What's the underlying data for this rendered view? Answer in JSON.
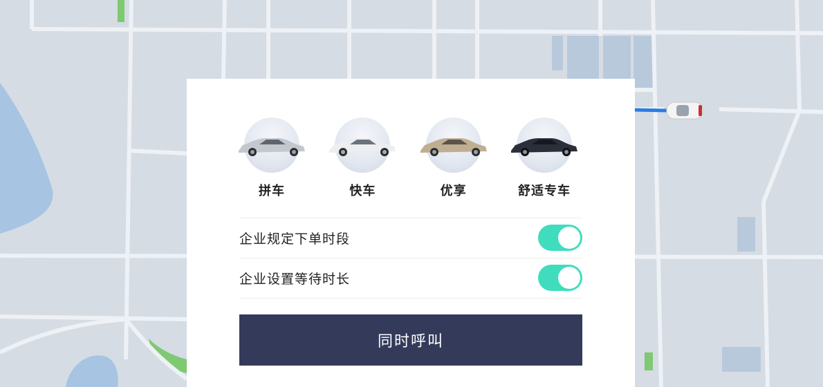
{
  "colors": {
    "accent": "#3fdcbd",
    "primary_button": "#333a5a",
    "map_bg": "#d5dce4",
    "route": "#2a7de1"
  },
  "ride_options": [
    {
      "label": "拼车",
      "icon": "car-silver-icon"
    },
    {
      "label": "快车",
      "icon": "car-white-icon"
    },
    {
      "label": "优享",
      "icon": "car-champagne-icon"
    },
    {
      "label": "舒适专车",
      "icon": "car-dark-icon"
    }
  ],
  "settings": [
    {
      "label": "企业规定下单时段",
      "enabled": true
    },
    {
      "label": "企业设置等待时长",
      "enabled": true
    }
  ],
  "call_button": {
    "label": "同时呼叫"
  }
}
